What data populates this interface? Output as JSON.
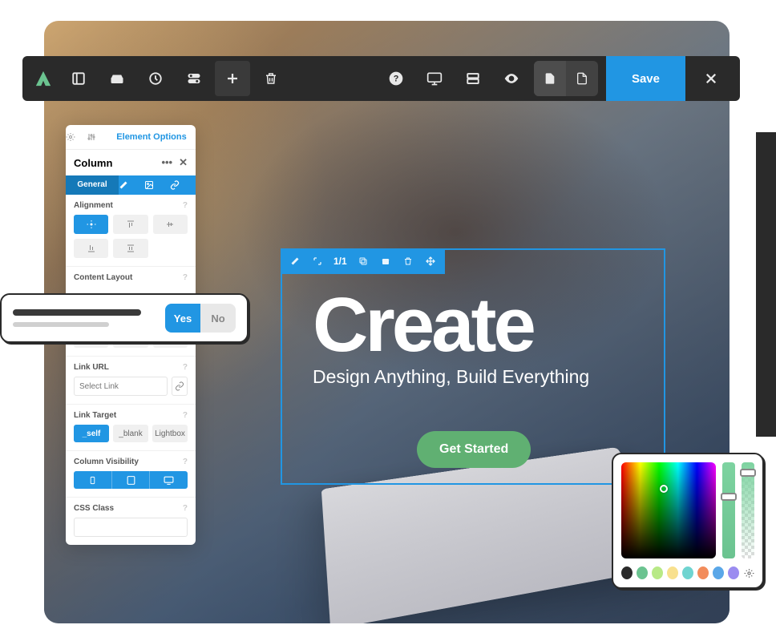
{
  "toolbar": {
    "save_label": "Save"
  },
  "panel": {
    "tabs_label": "Element Options",
    "title": "Column",
    "subtabs": {
      "general": "General"
    },
    "sections": {
      "alignment": "Alignment",
      "content_layout": "Content Layout",
      "link_url": "Link URL",
      "link_url_placeholder": "Select Link",
      "link_target": "Link Target",
      "targets": {
        "self": "_self",
        "blank": "_blank",
        "lightbox": "Lightbox"
      },
      "column_visibility": "Column Visibility",
      "css_class": "CSS Class"
    }
  },
  "toggle": {
    "yes": "Yes",
    "no": "No"
  },
  "hero": {
    "count": "1/1",
    "title": "Create",
    "subtitle": "Design Anything, Build Everything",
    "cta": "Get Started"
  },
  "picker": {
    "swatches": [
      "#2a2a2a",
      "#6bc390",
      "#b8e986",
      "#f8e08e",
      "#6fd4d0",
      "#f28c5b",
      "#5aa7e8",
      "#9b8cf0"
    ]
  }
}
